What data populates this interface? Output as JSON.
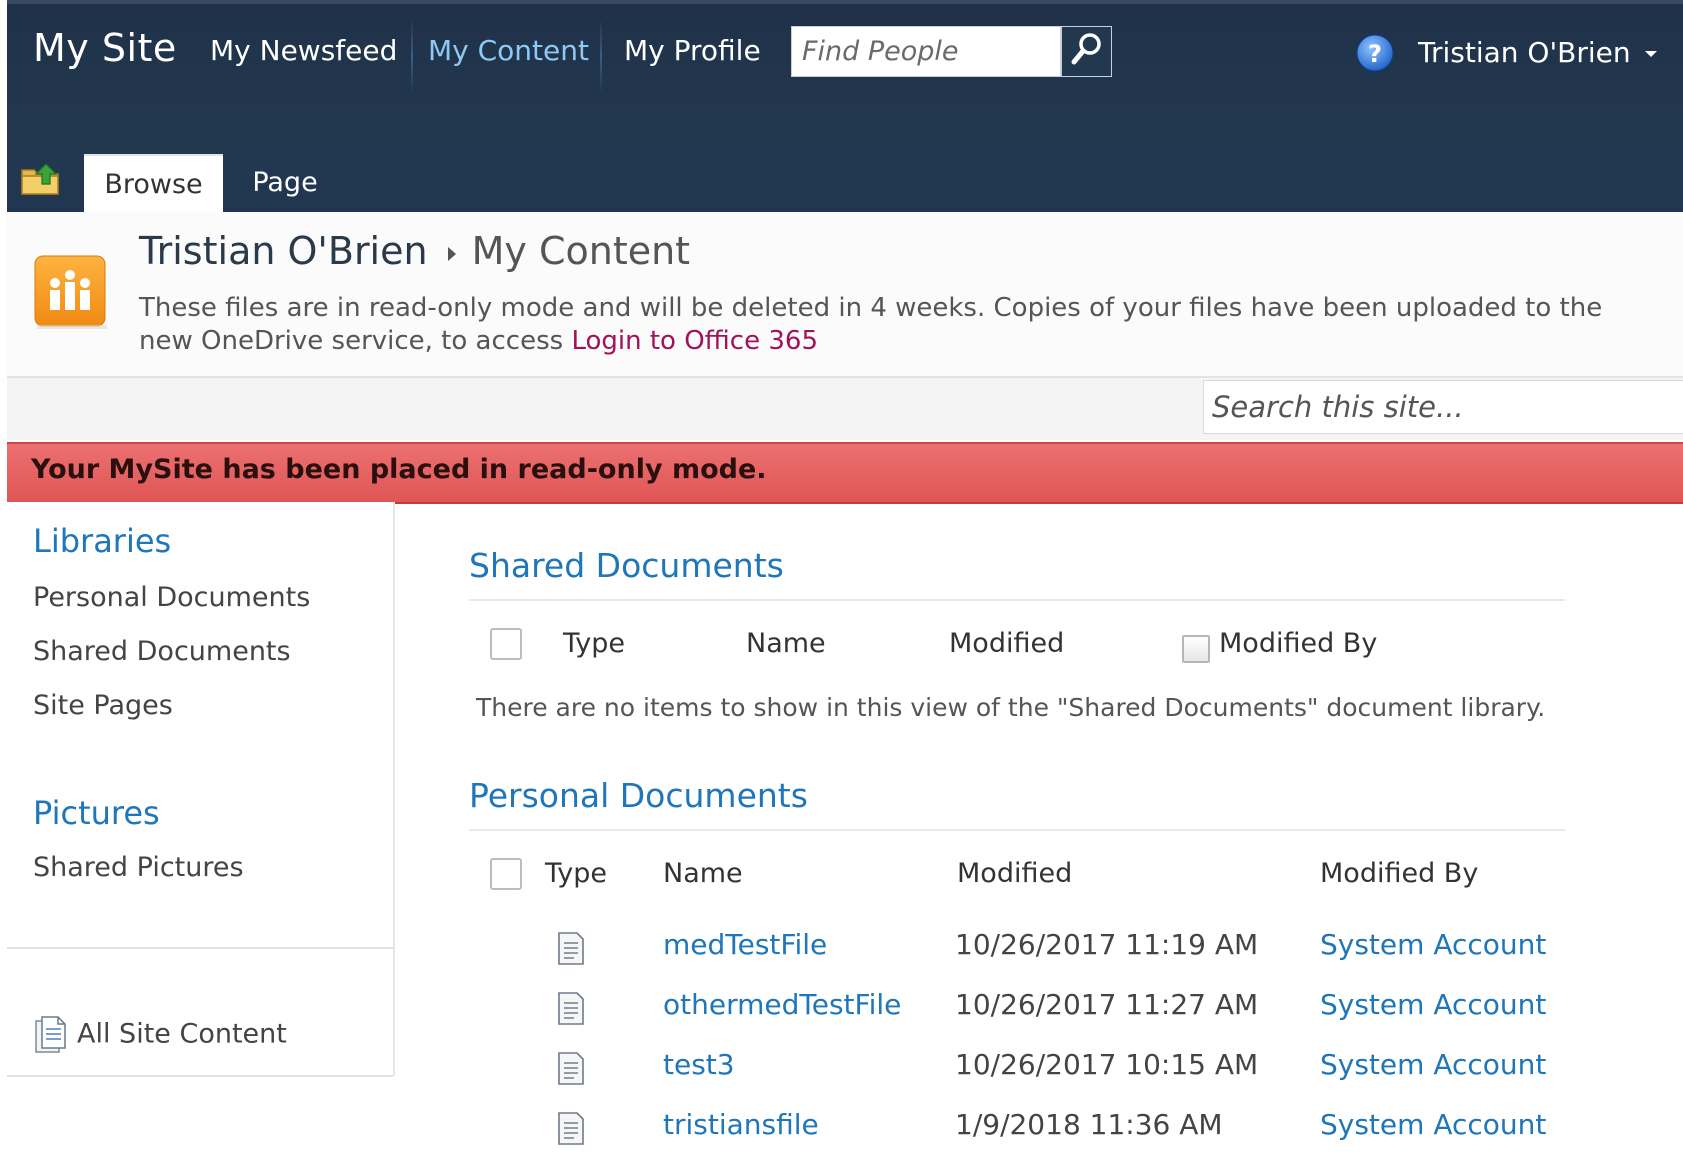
{
  "top_nav": {
    "site_title": "My Site",
    "links": [
      "My Newsfeed",
      "My Content",
      "My Profile"
    ],
    "find_placeholder": "Find People",
    "user_name": "Tristian O'Brien"
  },
  "ribbon": {
    "tabs": [
      "Browse",
      "Page"
    ]
  },
  "page_header": {
    "breadcrumb_root": "Tristian O'Brien",
    "breadcrumb_current": "My Content",
    "notice_text": "These files are in read-only mode and will be deleted in 4 weeks. Copies of your files have been uploaded to the new OneDrive service, to access ",
    "notice_link": "Login to Office 365"
  },
  "site_search": {
    "placeholder": "Search this site..."
  },
  "banner": {
    "message": "Your MySite has been placed in read-only mode."
  },
  "left_nav": {
    "libraries_heading": "Libraries",
    "libraries": [
      "Personal Documents",
      "Shared Documents",
      "Site Pages"
    ],
    "pictures_heading": "Pictures",
    "pictures": [
      "Shared Pictures"
    ],
    "all_site_content": "All Site Content"
  },
  "shared_documents": {
    "title": "Shared Documents",
    "columns": [
      "Type",
      "Name",
      "Modified",
      "Modified By"
    ],
    "empty_message": "There are no items to show in this view of the \"Shared Documents\" document library."
  },
  "personal_documents": {
    "title": "Personal Documents",
    "columns": [
      "Type",
      "Name",
      "Modified",
      "Modified By"
    ],
    "rows": [
      {
        "name": "medTestFile",
        "modified": "10/26/2017 11:19 AM",
        "modified_by": "System Account"
      },
      {
        "name": "othermedTestFile",
        "modified": "10/26/2017 11:27 AM",
        "modified_by": "System Account"
      },
      {
        "name": "test3",
        "modified": "10/26/2017 10:15 AM",
        "modified_by": "System Account"
      },
      {
        "name": "tristiansfile",
        "modified": "1/9/2018 11:36 AM",
        "modified_by": "System Account"
      }
    ]
  },
  "colors": {
    "top_bar": "#22384f",
    "link_blue": "#1f76b8",
    "active_nav": "#8fc8f3",
    "banner_red": "#e05656",
    "notice_link": "#a0125a"
  },
  "icons": [
    "search-icon",
    "help-icon",
    "ribbon-navigate-up-icon",
    "site-logo-icon",
    "document-icon",
    "all-site-content-icon"
  ]
}
